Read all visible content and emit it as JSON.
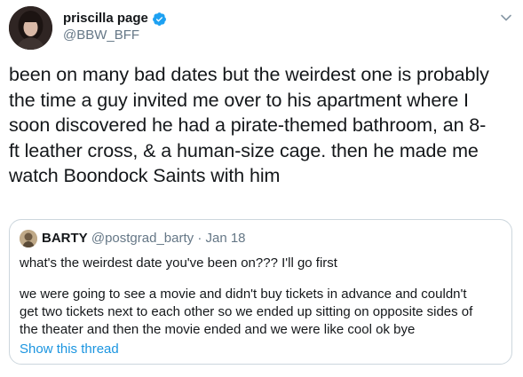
{
  "author": {
    "name": "priscilla page",
    "handle": "@BBW_BFF",
    "verified": true,
    "verified_color": "#1da1f2"
  },
  "icons": {
    "verified": "verified-badge-icon",
    "menu": "chevron-down-icon"
  },
  "tweet": {
    "text": "been on many bad dates but the weirdest one is probably\nthe time a guy invited me over to his apartment where I\nsoon discovered he had a pirate-themed bathroom, an 8-\nft leather cross, & a human-size cage. then he made me\nwatch Boondock Saints with him"
  },
  "quoted_tweet": {
    "name": "BARTY",
    "handle": "@postgrad_barty",
    "separator": "·",
    "date": "Jan 18",
    "text_line1": "what's the weirdest date you've been on??? I'll go first",
    "text_body": "we were going to see a movie and didn't buy tickets in advance and couldn't\nget two tickets next to each other so we ended up sitting on opposite sides of\nthe theater and then the movie ended and we were like cool ok bye",
    "show_thread": "Show this thread"
  },
  "colors": {
    "text_primary": "#14171a",
    "text_secondary": "#657786",
    "link": "#1b95e0",
    "border": "#ccd6dd"
  }
}
